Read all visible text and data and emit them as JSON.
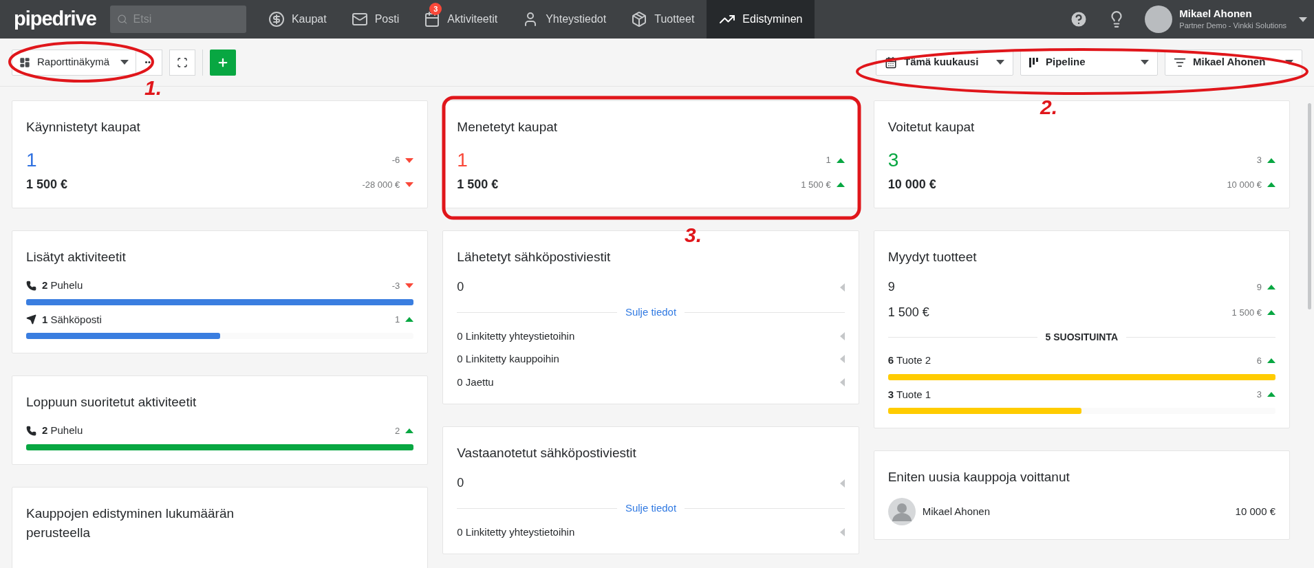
{
  "topbar": {
    "logo": "pipedrive",
    "search": {
      "placeholder": "Etsi"
    },
    "nav": [
      {
        "label": "Kaupat",
        "selected": false
      },
      {
        "label": "Posti",
        "selected": false
      },
      {
        "label": "Aktiviteetit",
        "selected": false,
        "badge": "3"
      },
      {
        "label": "Yhteystiedot",
        "selected": false
      },
      {
        "label": "Tuotteet",
        "selected": false
      },
      {
        "label": "Edistyminen",
        "selected": true
      }
    ],
    "user": {
      "name": "Mikael Ahonen",
      "company": "Partner Demo - Vinkki Solutions"
    }
  },
  "toolbar": {
    "view": "Raporttinäkymä",
    "filters": [
      "Tämä kuukausi",
      "Pipeline",
      "Mikael Ahonen"
    ]
  },
  "columns": [
    [
      {
        "kind": "deals",
        "title": "Käynnistetyt kaupat",
        "count": "1",
        "color": "#3172e0",
        "count_delta": "-6",
        "count_rising": false,
        "amount": "1 500 €",
        "amount_delta": "-28 000 €",
        "amount_rising": false
      },
      {
        "kind": "activities",
        "title": "Lisätyt aktiviteetit",
        "color": "#3a7ee0",
        "rows": [
          {
            "count": "2",
            "label": "Puhelu",
            "delta": "-3",
            "rising": false,
            "level": 1
          },
          {
            "count": "1",
            "label": "Sähköposti",
            "delta": "1",
            "rising": true,
            "level": 0.5
          }
        ]
      },
      {
        "kind": "activities",
        "title": "Loppuun suoritetut aktiviteetit",
        "color": "#08a742",
        "rows": [
          {
            "count": "2",
            "label": "Puhelu",
            "delta": "2",
            "rising": true,
            "level": 1
          }
        ]
      },
      {
        "kind": "title",
        "title": "Kauppojen edistyminen lukumäärän perusteella"
      }
    ],
    [
      {
        "kind": "deals",
        "title": "Menetetyt kaupat",
        "count": "1",
        "color": "#f94839",
        "count_delta": "1",
        "count_rising": true,
        "amount": "1 500 €",
        "amount_delta": "1 500 €",
        "amount_rising": true
      },
      {
        "kind": "emails",
        "title": "Lähetetyt sähköpostiviestit",
        "value": "0",
        "link": "Sulje tiedot",
        "rows": [
          "0 Linkitetty yhteystietoihin",
          "0 Linkitetty kauppoihin",
          "0 Jaettu"
        ]
      },
      {
        "kind": "emails",
        "title": "Vastaanotetut sähköpostiviestit",
        "value": "0",
        "link": "Sulje tiedot",
        "rows": [
          "0 Linkitetty yhteystietoihin"
        ]
      }
    ],
    [
      {
        "kind": "deals",
        "title": "Voitetut kaupat",
        "count": "3",
        "color": "#08a742",
        "count_delta": "3",
        "count_rising": true,
        "amount": "10 000 €",
        "amount_delta": "10 000 €",
        "amount_rising": true
      },
      {
        "kind": "products",
        "title": "Myydyt tuotteet",
        "count": "9",
        "count_delta": "9",
        "count_rising": true,
        "amount": "1 500 €",
        "amount_delta": "1 500 €",
        "amount_rising": true,
        "section": "5 SUOSITUINTA",
        "color": "#ffcc00",
        "rows": [
          {
            "count": "6",
            "label": "Tuote 2",
            "delta": "6",
            "rising": true,
            "level": 1
          },
          {
            "count": "3",
            "label": "Tuote 1",
            "delta": "3",
            "rising": true,
            "level": 0.5
          }
        ]
      },
      {
        "kind": "leader",
        "title": "Eniten uusia kauppoja voittanut",
        "name": "Mikael Ahonen",
        "amount": "10 000 €"
      }
    ]
  ],
  "annotations": [
    "1.",
    "2.",
    "3."
  ]
}
